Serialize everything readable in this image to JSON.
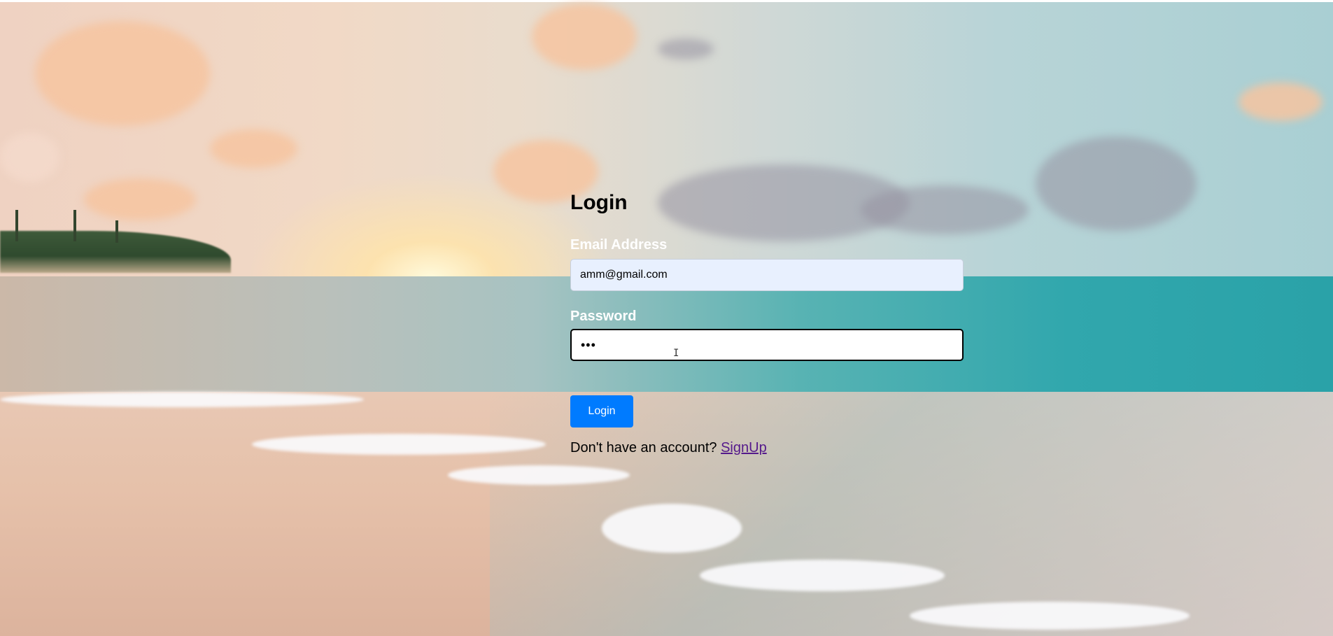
{
  "login": {
    "title": "Login",
    "email_label": "Email Address",
    "email_value": "amm@gmail.com",
    "password_label": "Password",
    "password_value": "•••",
    "button_label": "Login",
    "signup_prompt": "Don't have an account?",
    "signup_link": "SignUp"
  },
  "colors": {
    "button_bg": "#007bff",
    "email_input_bg": "#e8f0fe",
    "link_visited": "#551a8b"
  },
  "background": {
    "scene": "beach-sunset-photo"
  }
}
